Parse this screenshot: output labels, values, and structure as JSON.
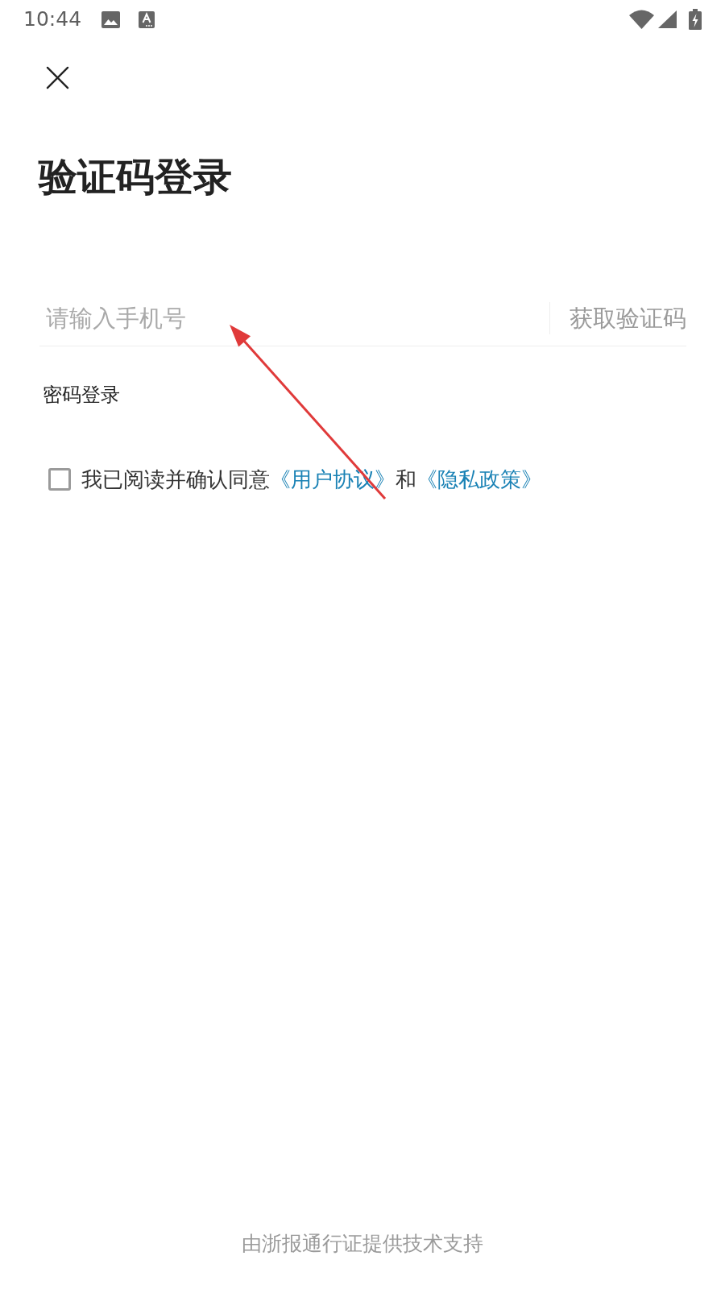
{
  "status_bar": {
    "time": "10:44"
  },
  "title": "验证码登录",
  "phone_field": {
    "placeholder": "请输入手机号"
  },
  "get_code_button": {
    "label": "获取验证码"
  },
  "password_login_link": {
    "label": "密码登录"
  },
  "agreement": {
    "checked": false,
    "parts": [
      {
        "kind": "text",
        "text": "我已阅读并确认同意"
      },
      {
        "kind": "link",
        "text": "《用户协议》"
      },
      {
        "kind": "text",
        "text": "和"
      },
      {
        "kind": "link",
        "text": "《隐私政策》"
      }
    ]
  },
  "footer": "由浙报通行证提供技术支持"
}
